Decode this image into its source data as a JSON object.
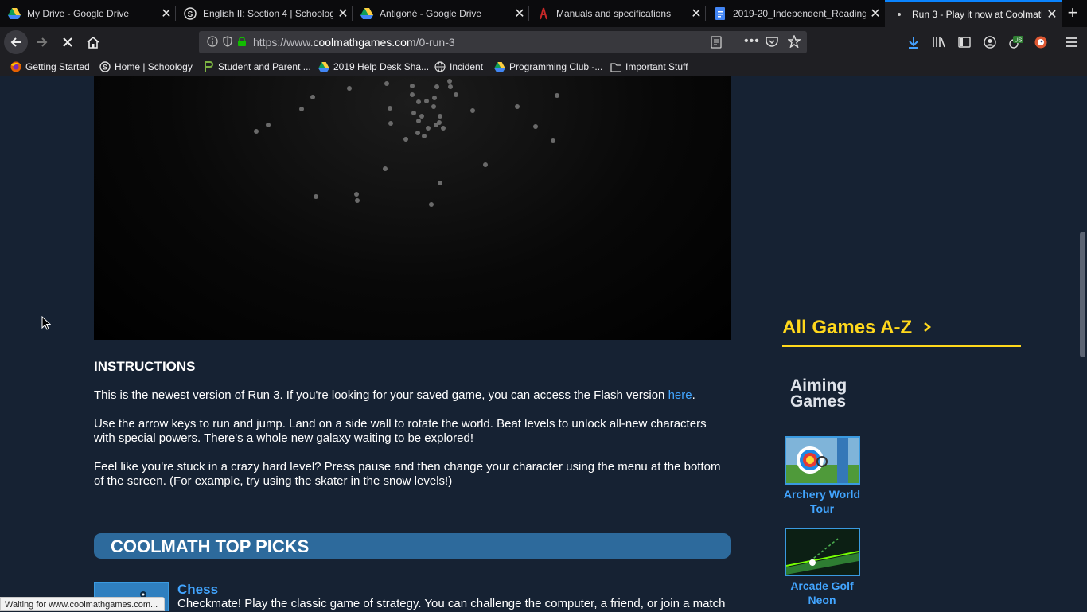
{
  "browser": {
    "tabs": [
      {
        "title": "My Drive - Google Drive",
        "icon": "google-drive-icon"
      },
      {
        "title": "English II: Section 4 | Schoolog",
        "icon": "schoology-icon"
      },
      {
        "title": "Antigoné - Google Drive",
        "icon": "google-drive-icon"
      },
      {
        "title": "Manuals and specifications",
        "icon": "manual-icon"
      },
      {
        "title": "2019-20_Independent_Reading",
        "icon": "google-docs-icon"
      },
      {
        "title": "Run 3 - Play it now at Coolmath",
        "icon": "coolmath-icon"
      }
    ],
    "active_tab_index": 5,
    "url_prefix": "https://www.",
    "url_domain": "coolmathgames.com",
    "url_path": "/0-run-3",
    "bookmarks": [
      {
        "label": "Getting Started",
        "icon": "firefox-icon"
      },
      {
        "label": "Home | Schoology",
        "icon": "schoology-icon"
      },
      {
        "label": "Student and Parent ...",
        "icon": "student-portal-icon"
      },
      {
        "label": "2019 Help Desk Sha...",
        "icon": "google-drive-icon"
      },
      {
        "label": "Incident",
        "icon": "globe-icon"
      },
      {
        "label": "Programming Club -...",
        "icon": "google-drive-icon"
      },
      {
        "label": "Important Stuff",
        "icon": "folder-icon"
      }
    ],
    "extension_badge": "US",
    "status_text": "Waiting for www.coolmathgames.com..."
  },
  "page": {
    "instructions_heading": "INSTRUCTIONS",
    "para1_text": "This is the newest version of Run 3. If you're looking for your saved game, you can access the Flash version ",
    "para1_link": "here",
    "para1_end": ".",
    "para2": "Use the arrow keys to run and jump. Land on a side wall to rotate the world. Beat levels to unlock all-new characters with special powers. There's a whole new galaxy waiting to be explored!",
    "para3": "Feel like you're stuck in a crazy hard level? Press pause and then change your character using the menu at the bottom of the screen. (For example, try using the skater in the snow levels!)",
    "top_picks_heading": "COOLMATH TOP PICKS",
    "top_picks": [
      {
        "title": "Chess",
        "description": "Checkmate! Play the classic game of strategy. You can challenge the computer, a friend, or join a match"
      }
    ]
  },
  "sidebar": {
    "all_games_label": "All Games A-Z",
    "category_heading": "Aiming Games",
    "games": [
      {
        "title": "Archery World Tour"
      },
      {
        "title": "Arcade Golf Neon"
      }
    ]
  },
  "colors": {
    "page_background": "#162233",
    "accent_yellow": "#ffd81c",
    "link_blue": "#42a5ff",
    "top_picks_bar": "#2d6a9c"
  }
}
